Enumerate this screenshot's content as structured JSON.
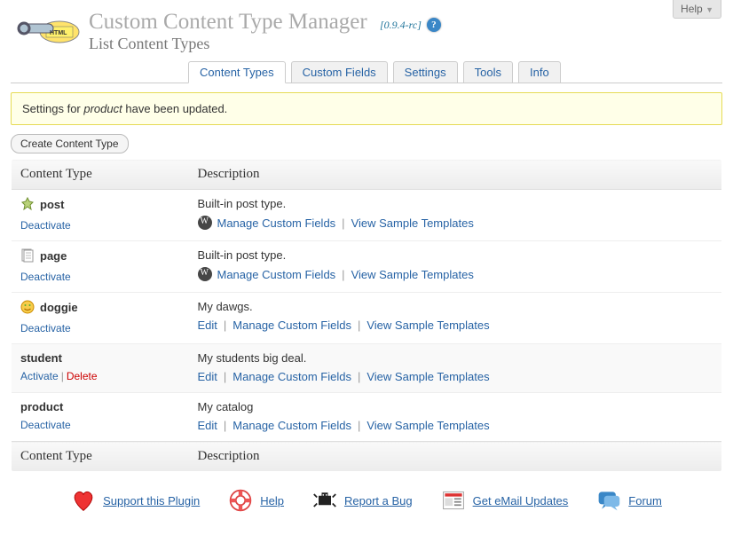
{
  "header": {
    "help_tab": "Help",
    "app_title": "Custom Content Type Manager",
    "subtitle": "List Content Types",
    "version": "[0.9.4-rc]"
  },
  "tabs": [
    {
      "label": "Content Types",
      "active": true
    },
    {
      "label": "Custom Fields",
      "active": false
    },
    {
      "label": "Settings",
      "active": false
    },
    {
      "label": "Tools",
      "active": false
    },
    {
      "label": "Info",
      "active": false
    }
  ],
  "notice": {
    "prefix": "Settings for ",
    "em": "product",
    "suffix": " have been updated."
  },
  "create_button": "Create Content Type",
  "columns": {
    "name": "Content Type",
    "desc": "Description"
  },
  "action_labels": {
    "deactivate": "Deactivate",
    "activate": "Activate",
    "delete": "Delete",
    "edit": "Edit",
    "manage_fields": "Manage Custom Fields",
    "view_templates": "View Sample Templates"
  },
  "rows": [
    {
      "name": "post",
      "desc": "Built-in post type.",
      "has_icon": true,
      "builtin": true,
      "name_actions": [
        "deactivate"
      ]
    },
    {
      "name": "page",
      "desc": "Built-in post type.",
      "has_icon": true,
      "builtin": true,
      "name_actions": [
        "deactivate"
      ]
    },
    {
      "name": "doggie",
      "desc": "My dawgs.",
      "has_icon": true,
      "builtin": false,
      "name_actions": [
        "deactivate"
      ]
    },
    {
      "name": "student",
      "desc": "My students big deal.",
      "has_icon": false,
      "builtin": false,
      "name_actions": [
        "activate",
        "delete"
      ]
    },
    {
      "name": "product",
      "desc": "My catalog",
      "has_icon": false,
      "builtin": false,
      "name_actions": [
        "deactivate"
      ]
    }
  ],
  "footer": [
    {
      "label": "Support this Plugin",
      "icon": "heart"
    },
    {
      "label": "Help",
      "icon": "lifebuoy"
    },
    {
      "label": "Report a Bug",
      "icon": "bug"
    },
    {
      "label": "Get eMail Updates",
      "icon": "news"
    },
    {
      "label": "Forum",
      "icon": "chat"
    }
  ]
}
